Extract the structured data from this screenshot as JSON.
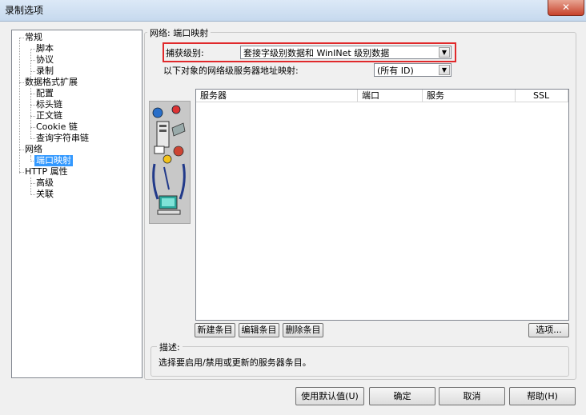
{
  "window": {
    "title": "录制选项",
    "close_label": "✕"
  },
  "tree": {
    "items": [
      {
        "label": "常规"
      },
      {
        "label": "脚本"
      },
      {
        "label": "协议"
      },
      {
        "label": "录制"
      },
      {
        "label": "数据格式扩展"
      },
      {
        "label": "配置"
      },
      {
        "label": "标头链"
      },
      {
        "label": "正文链"
      },
      {
        "label": "Cookie 链"
      },
      {
        "label": "查询字符串链"
      },
      {
        "label": "网络"
      },
      {
        "label": "端口映射",
        "selected": true
      },
      {
        "label": "HTTP 属性"
      },
      {
        "label": "高级"
      },
      {
        "label": "关联"
      }
    ]
  },
  "panel": {
    "group_title": "网络: 端口映射",
    "capture_label": "捕获级别:",
    "capture_value": "套接字级别数据和 WinINet 级别数据",
    "map_label": "以下对象的网络级服务器地址映射:",
    "map_value": "(所有 ID)",
    "columns": [
      "服务器",
      "端口",
      "服务",
      "SSL"
    ],
    "rows": [],
    "buttons": {
      "new_entry": "新建条目",
      "edit_entry": "编辑条目",
      "delete_entry": "删除条目",
      "options": "选项..."
    },
    "description": {
      "title": "描述:",
      "text": "选择要启用/禁用或更新的服务器条目。"
    }
  },
  "footer": {
    "use_default": "使用默认值(U)",
    "ok": "确定",
    "cancel": "取消",
    "help": "帮助(H)"
  },
  "colors": {
    "highlight": "#e0292b",
    "selection": "#3399ff"
  },
  "icons": [
    "network-devices-icon",
    "server-icon",
    "computer-icon"
  ]
}
